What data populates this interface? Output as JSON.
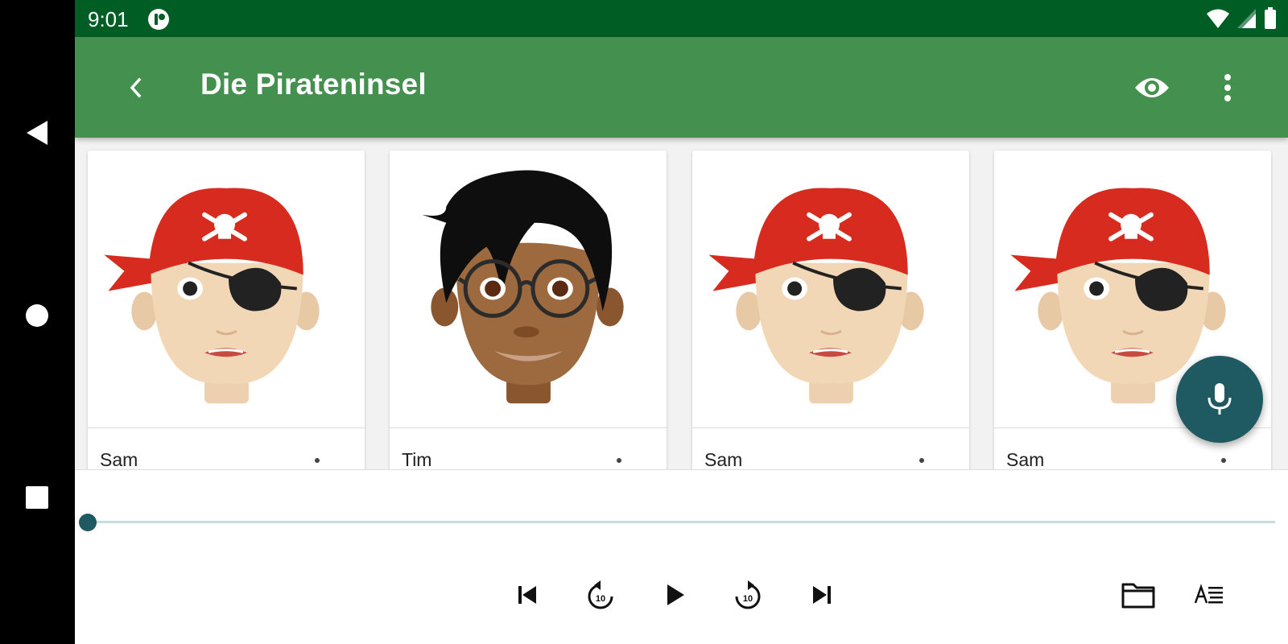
{
  "status_bar": {
    "time": "9:01"
  },
  "app_bar": {
    "title": "Die Pirateninsel"
  },
  "characters": [
    {
      "name": "Sam",
      "avatar": "pirate-avatar"
    },
    {
      "name": "Tim",
      "avatar": "boy-glasses-avatar"
    },
    {
      "name": "Sam",
      "avatar": "pirate-avatar"
    },
    {
      "name": "Sam",
      "avatar": "pirate-avatar"
    }
  ],
  "player": {
    "progress": 0
  },
  "colors": {
    "status_bar": "#005e25",
    "app_bar": "#43904f",
    "accent": "#1f5961",
    "track": "#c6dedb"
  },
  "icons": [
    "back-icon",
    "eye-icon",
    "more-vert-icon",
    "microphone-icon",
    "skip-previous-icon",
    "replay-10-icon",
    "play-icon",
    "forward-10-icon",
    "skip-next-icon",
    "folder-icon",
    "text-format-icon"
  ]
}
